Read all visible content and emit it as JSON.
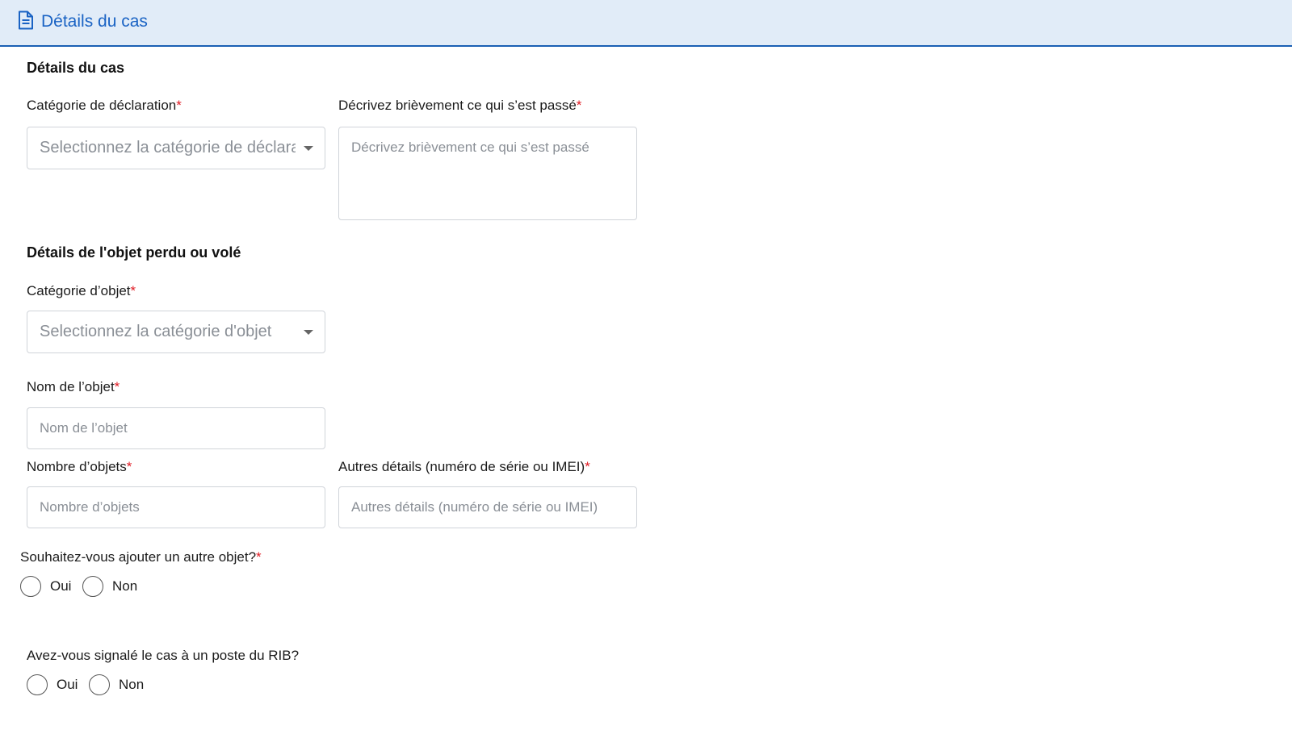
{
  "header": {
    "title": "Détails du cas",
    "icon": "document-icon"
  },
  "sections": {
    "case_details": "Détails du cas",
    "object_details": "Détails de l'objet perdu ou volé"
  },
  "fields": {
    "declaration_category": {
      "label": "Catégorie de déclaration",
      "placeholder": "Selectionnez la catégorie de déclaration"
    },
    "description": {
      "label": "Décrivez brièvement ce qui s’est passé",
      "placeholder": "Décrivez brièvement ce qui s’est passé"
    },
    "object_category": {
      "label": "Catégorie d’objet",
      "placeholder": "Selectionnez la catégorie d'objet"
    },
    "object_name": {
      "label": "Nom de l’objet",
      "placeholder": "Nom de l’objet"
    },
    "object_count": {
      "label": "Nombre d’objets",
      "placeholder": "Nombre d’objets"
    },
    "other_details": {
      "label": "Autres détails (numéro de série ou IMEI)",
      "placeholder": "Autres détails (numéro de série ou IMEI)"
    }
  },
  "required_marker": "*",
  "questions": {
    "add_another": {
      "label": "Souhaitez-vous ajouter un autre objet?",
      "yes": "Oui",
      "no": "Non"
    },
    "reported_rib": {
      "label": "Avez-vous signalé le cas à un poste du RIB?",
      "yes": "Oui",
      "no": "Non"
    }
  },
  "colors": {
    "accent": "#1a63c4",
    "header_bg": "#e1ecf8",
    "required": "#e01b24"
  }
}
